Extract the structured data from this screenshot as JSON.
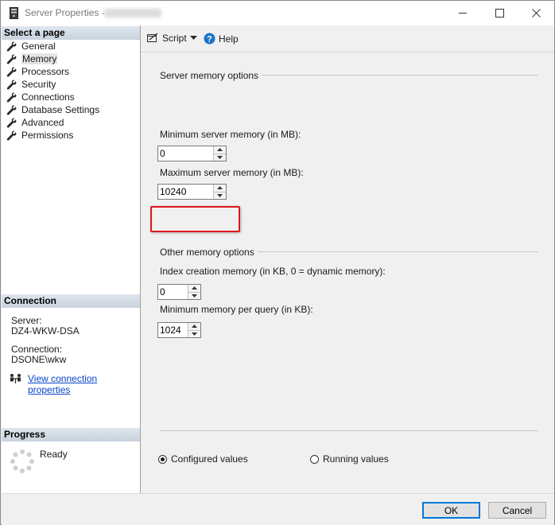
{
  "window": {
    "title": "Server Properties - "
  },
  "left": {
    "select_page_header": "Select a page",
    "pages": [
      {
        "label": "General",
        "selected": false
      },
      {
        "label": "Memory",
        "selected": true
      },
      {
        "label": "Processors",
        "selected": false
      },
      {
        "label": "Security",
        "selected": false
      },
      {
        "label": "Connections",
        "selected": false
      },
      {
        "label": "Database Settings",
        "selected": false
      },
      {
        "label": "Advanced",
        "selected": false
      },
      {
        "label": "Permissions",
        "selected": false
      }
    ],
    "connection_header": "Connection",
    "server_label": "Server:",
    "server_value": "DZ4-WKW-DSA",
    "connection_label": "Connection:",
    "connection_value": "DSONE\\wkw",
    "view_link": "View connection properties",
    "progress_header": "Progress",
    "progress_status": "Ready"
  },
  "toolbar": {
    "script_label": "Script",
    "help_label": "Help"
  },
  "memory": {
    "server_memory_group": "Server memory options",
    "min_label": "Minimum server memory (in MB):",
    "min_value": "0",
    "max_label": "Maximum server memory (in MB):",
    "max_value": "10240",
    "other_group": "Other memory options",
    "index_label": "Index creation memory (in KB, 0 = dynamic memory):",
    "index_value": "0",
    "query_label": "Minimum memory per query (in KB):",
    "query_value": "1024",
    "configured_label": "Configured values",
    "running_label": "Running values",
    "selected_option": "Configured values"
  },
  "buttons": {
    "ok": "OK",
    "cancel": "Cancel"
  },
  "colors": {
    "highlight_box": "#e0161c",
    "link": "#0645c8",
    "help_icon": "#1c73c6",
    "default_button_border": "#0078d7"
  },
  "icons": {
    "page_item": "wrench-icon",
    "help": "help-icon",
    "connection": "network-icon",
    "progress": "spinner-icon"
  }
}
